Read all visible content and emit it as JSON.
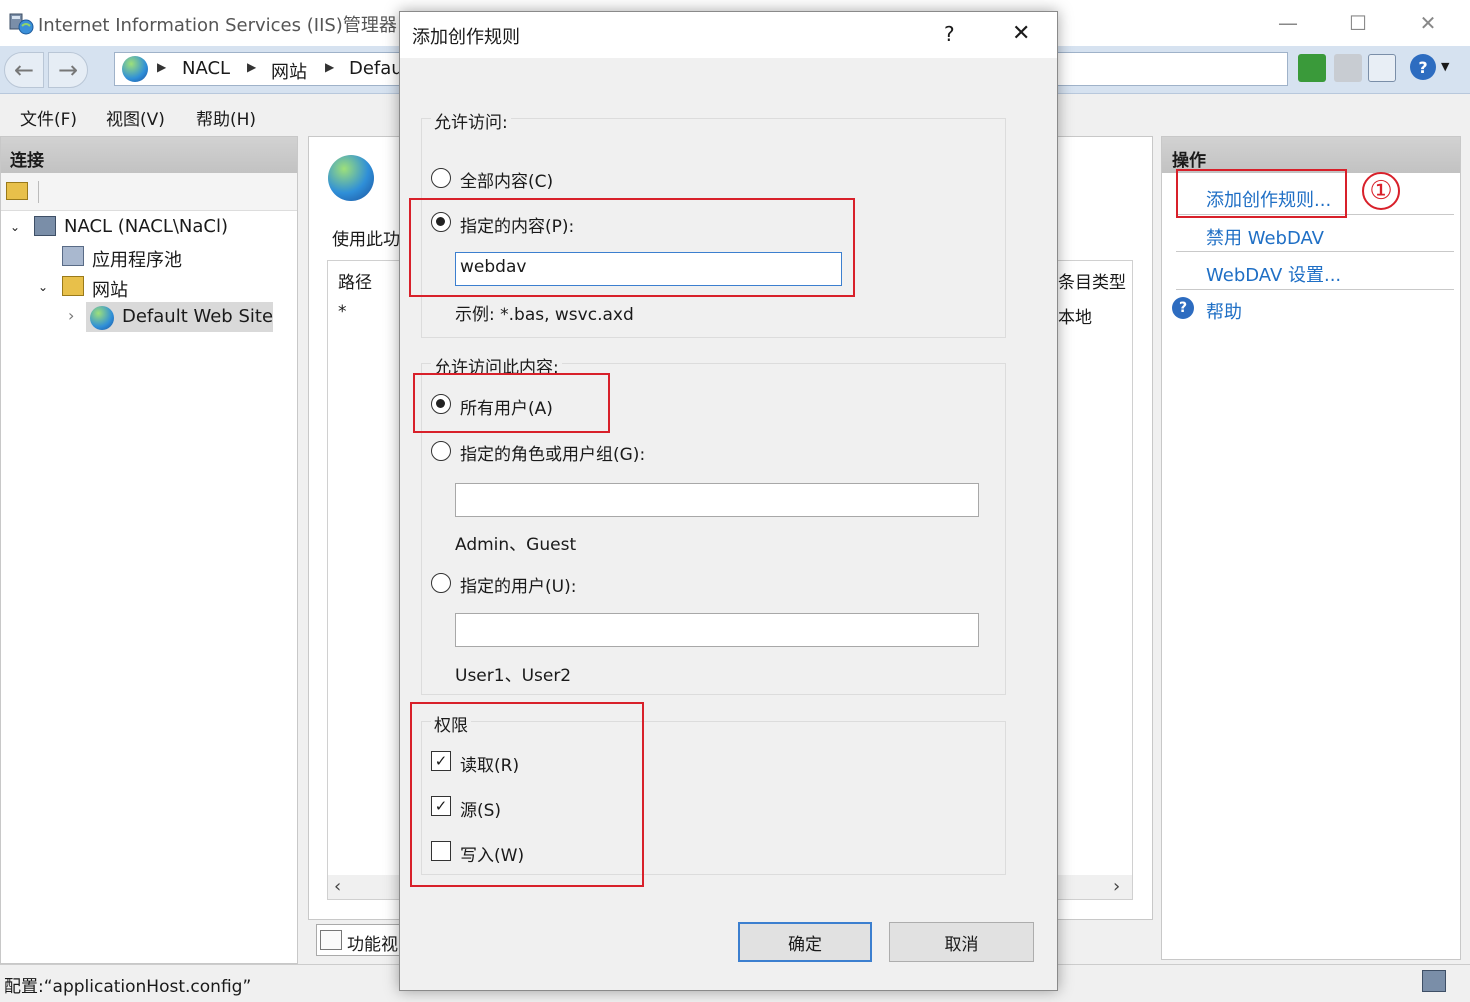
{
  "window": {
    "title": "Internet Information Services (IIS)管理器",
    "minimize": "—",
    "maximize": "☐",
    "close": "✕"
  },
  "address": {
    "crumbs": [
      "NACL",
      "网站",
      "Defau"
    ]
  },
  "menu": [
    "文件(F)",
    "视图(V)",
    "帮助(H)"
  ],
  "connections": {
    "header": "连接",
    "tree": {
      "server": "NACL (NACL\\NaCl)",
      "app_pools": "应用程序池",
      "sites": "网站",
      "default_site": "Default Web Site"
    }
  },
  "center": {
    "desc": "使用此功",
    "col_path": "路径",
    "col_type": "条目类型",
    "row_path": "*",
    "row_type": "本地",
    "feature_view_tab": "功能视"
  },
  "actions": {
    "header": "操作",
    "add_rule": "添加创作规则...",
    "disable_webdav": "禁用 WebDAV",
    "webdav_settings": "WebDAV 设置...",
    "help": "帮助",
    "annotation": "①"
  },
  "status": {
    "text": "配置:“applicationHost.config”"
  },
  "dialog": {
    "title": "添加创作规则",
    "help_btn": "?",
    "close_btn": "✕",
    "allow_access_label": "允许访问:",
    "all_content": "全部内容(C)",
    "specified_content": "指定的内容(P):",
    "content_value": "webdav",
    "content_example": "示例: *.bas, wsvc.axd",
    "allow_users_label": "允许访问此内容:",
    "all_users": "所有用户(A)",
    "roles_groups": "指定的角色或用户组(G):",
    "roles_value": "",
    "roles_example": "Admin、Guest",
    "specified_users": "指定的用户(U):",
    "users_value": "",
    "users_example": "User1、User2",
    "permissions_label": "权限",
    "perm_read": "读取(R)",
    "perm_source": "源(S)",
    "perm_write": "写入(W)",
    "ok": "确定",
    "cancel": "取消"
  },
  "colors": {
    "accent_link": "#1f6fc5",
    "highlight_box": "#d8202a",
    "default_button_border": "#3c7fcf"
  }
}
